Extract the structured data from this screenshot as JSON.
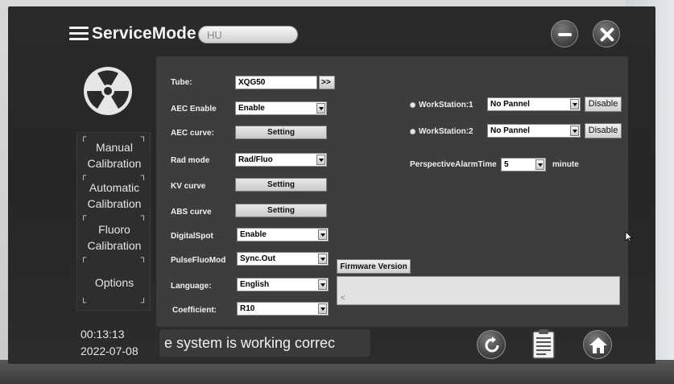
{
  "app": {
    "title": "ServiceMode",
    "hu_text": "HU"
  },
  "sidebar": {
    "items": [
      {
        "label_line1": "Manual",
        "label_line2": "Calibration"
      },
      {
        "label_line1": "Automatic",
        "label_line2": "Calibration"
      },
      {
        "label_line1": "Fluoro",
        "label_line2": "Calibration"
      },
      {
        "label_line1": "Options",
        "label_line2": ""
      }
    ]
  },
  "settings": {
    "tube": {
      "label": "Tube:",
      "value": "XQG50",
      "nav": ">>"
    },
    "aec_enable": {
      "label": "AEC Enable",
      "value": "Enable"
    },
    "aec_curve": {
      "label": "AEC curve:",
      "button": "Setting"
    },
    "rad_mode": {
      "label": "Rad mode",
      "value": "Rad/Fluo"
    },
    "kv_curve": {
      "label": "KV curve",
      "button": "Setting"
    },
    "abs_curve": {
      "label": "ABS curve",
      "button": "Setting"
    },
    "digital_spot": {
      "label": "DigitalSpot",
      "value": "Enable"
    },
    "pulse_fluo": {
      "label": "PulseFluoMod",
      "value": "Sync.Out"
    },
    "language": {
      "label": "Language:",
      "value": "English"
    },
    "coefficient": {
      "label": "Coefficient:",
      "value": "R10"
    }
  },
  "workstations": [
    {
      "label": "WorkStation:1",
      "value": "No Pannel",
      "button": "Disable"
    },
    {
      "label": "WorkStation:2",
      "value": "No Pannel",
      "button": "Disable"
    }
  ],
  "alarm": {
    "label": "PerspectiveAlarmTime",
    "value": "5",
    "unit": "minute"
  },
  "firmware": {
    "button": "Firmware Version",
    "scroll_glyph": "<"
  },
  "footer": {
    "time": "00:13:13",
    "date": "2022-07-08",
    "status": "e system is working correc"
  }
}
